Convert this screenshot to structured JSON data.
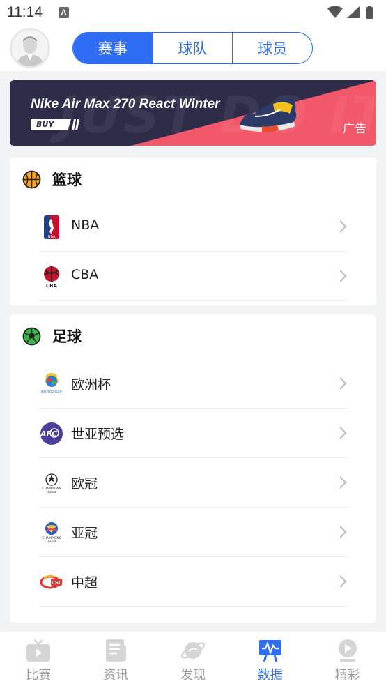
{
  "status_bar": {
    "time": "11:14",
    "notif_letter": "A"
  },
  "segments": [
    {
      "label": "赛事",
      "active": true
    },
    {
      "label": "球队",
      "active": false
    },
    {
      "label": "球员",
      "active": false
    }
  ],
  "banner": {
    "title": "Nike Air Max 270 React Winter",
    "buy": "BUY",
    "watermark": "JUST DO IT",
    "ad_label": "广告",
    "colors": {
      "dark": "#2f2c49",
      "pink": "#f3576a"
    }
  },
  "basketball": {
    "title": "篮球",
    "icon": "basketball-icon",
    "items": [
      {
        "label": "NBA",
        "logo": "nba-logo"
      },
      {
        "label": "CBA",
        "logo": "cba-logo"
      }
    ]
  },
  "football": {
    "title": "足球",
    "icon": "football-icon",
    "items": [
      {
        "label": "欧洲杯",
        "logo": "euro-logo"
      },
      {
        "label": "世亚预选",
        "logo": "afc-logo"
      },
      {
        "label": "欧冠",
        "logo": "champions-league-logo"
      },
      {
        "label": "亚冠",
        "logo": "afc-champions-league-logo"
      },
      {
        "label": "中超",
        "logo": "csl-logo"
      }
    ]
  },
  "bottom_nav": [
    {
      "label": "比赛",
      "icon": "tv-icon",
      "active": false
    },
    {
      "label": "资讯",
      "icon": "news-icon",
      "active": false
    },
    {
      "label": "发现",
      "icon": "planet-icon",
      "active": false
    },
    {
      "label": "数据",
      "icon": "data-chart-icon",
      "active": true
    },
    {
      "label": "精彩",
      "icon": "play-icon",
      "active": false
    }
  ],
  "accent_color": "#2f6df5"
}
